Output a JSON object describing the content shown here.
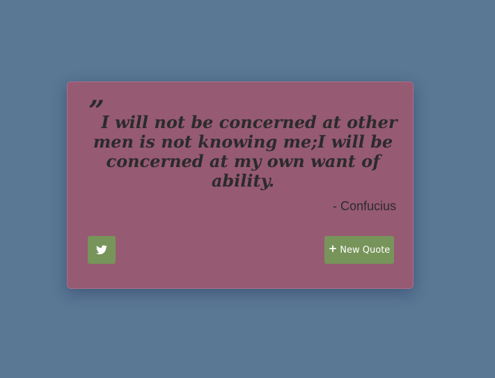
{
  "quote": {
    "mark": "”",
    "text": "I will not be concerned at other men is not knowing me;I will be concerned at my own want of ability.",
    "author": "- Confucius"
  },
  "actions": {
    "tweet_icon": "twitter-icon",
    "new_quote_icon": "plus-icon",
    "new_quote_plus": "+",
    "new_quote_label": "New Quote"
  },
  "colors": {
    "background": "#5a7794",
    "card": "#965a73",
    "button": "#77945a",
    "text": "#2b2b2b"
  }
}
